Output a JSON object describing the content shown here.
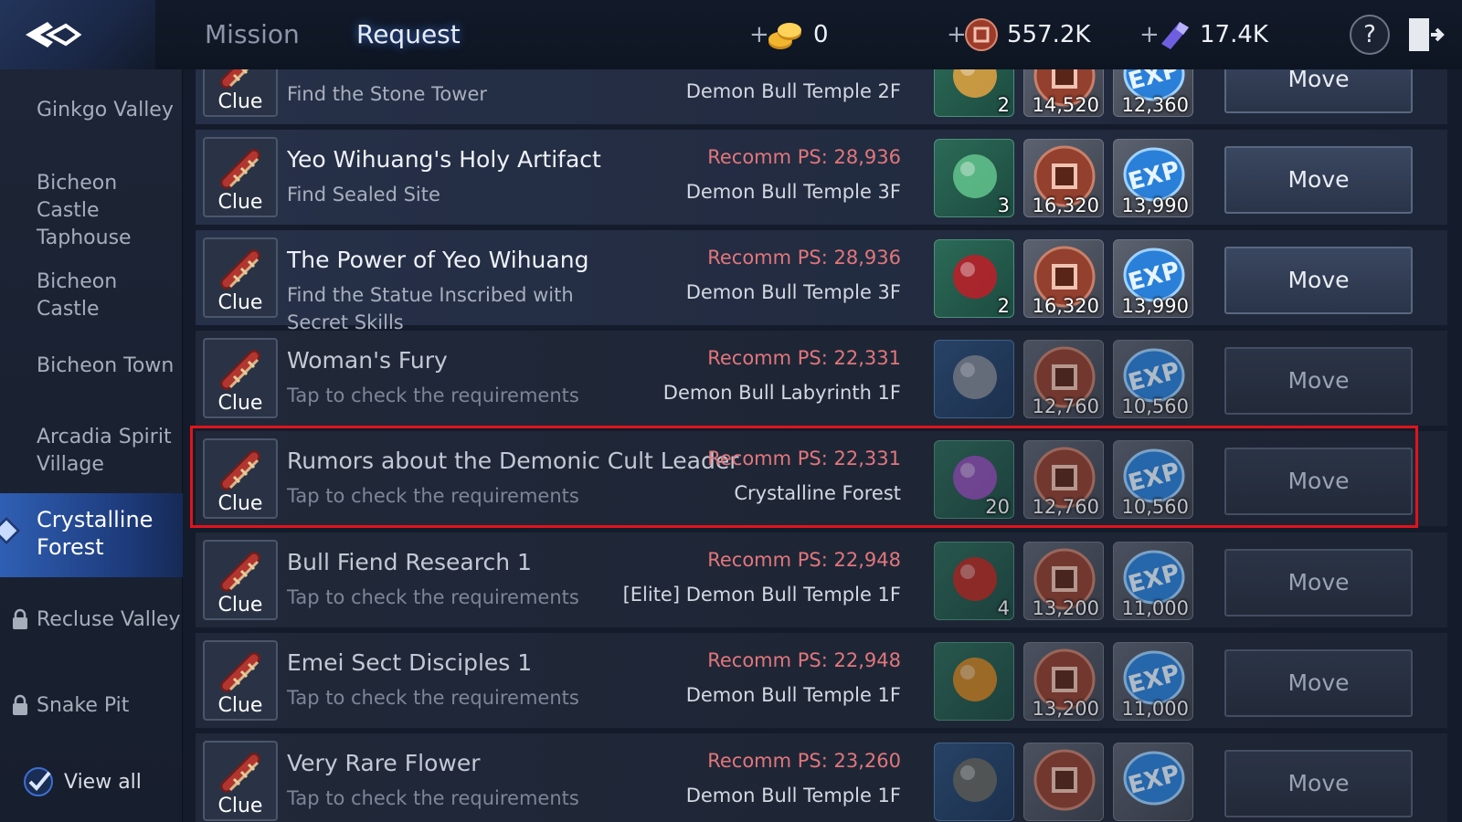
{
  "header": {
    "tabs": [
      {
        "label": "Mission"
      },
      {
        "label": "Request"
      }
    ],
    "currencies": {
      "gold": "0",
      "coin": "557.2K",
      "crystal": "17.4K"
    },
    "plus": "+",
    "help": "?"
  },
  "sidebar": {
    "items": [
      {
        "label": "Ginkgo Valley"
      },
      {
        "label": "Bicheon Castle Taphouse"
      },
      {
        "label": "Bicheon Castle"
      },
      {
        "label": "Bicheon Town"
      },
      {
        "label": "Arcadia Spirit Village"
      },
      {
        "label": "Crystalline Forest"
      },
      {
        "label": "Recluse Valley"
      },
      {
        "label": "Snake Pit"
      }
    ],
    "view_all": "View all"
  },
  "quests": [
    {
      "title": "",
      "desc": "Find the Stone Tower",
      "ps": "",
      "location": "Demon Bull Temple 2F",
      "item_count": "2",
      "coins": "14,520",
      "exp": "12,360",
      "move": "Move",
      "clue": "Clue"
    },
    {
      "title": "Yeo Wihuang's Holy Artifact",
      "desc": "Find Sealed Site",
      "ps": "Recomm PS: 28,936",
      "location": "Demon Bull Temple 3F",
      "item_count": "3",
      "coins": "16,320",
      "exp": "13,990",
      "move": "Move",
      "clue": "Clue"
    },
    {
      "title": "The Power of Yeo Wihuang",
      "desc": "Find the Statue Inscribed with Secret Skills",
      "ps": "Recomm PS: 28,936",
      "location": "Demon Bull Temple 3F",
      "item_count": "2",
      "coins": "16,320",
      "exp": "13,990",
      "move": "Move",
      "clue": "Clue"
    },
    {
      "title": "Woman's Fury",
      "desc": "Tap to check the requirements",
      "ps": "Recomm PS: 22,331",
      "location": "Demon Bull Labyrinth 1F",
      "item_count": "",
      "coins": "12,760",
      "exp": "10,560",
      "move": "Move",
      "clue": "Clue"
    },
    {
      "title": "Rumors about the Demonic Cult Leader",
      "desc": "Tap to check the requirements",
      "ps": "Recomm PS: 22,331",
      "location": "Crystalline Forest",
      "item_count": "20",
      "coins": "12,760",
      "exp": "10,560",
      "move": "Move",
      "clue": "Clue"
    },
    {
      "title": "Bull Fiend Research 1",
      "desc": "Tap to check the requirements",
      "ps": "Recomm PS: 22,948",
      "location": "[Elite] Demon Bull Temple 1F",
      "item_count": "4",
      "coins": "13,200",
      "exp": "11,000",
      "move": "Move",
      "clue": "Clue"
    },
    {
      "title": "Emei Sect Disciples 1",
      "desc": "Tap to check the requirements",
      "ps": "Recomm PS: 22,948",
      "location": "Demon Bull Temple 1F",
      "item_count": "",
      "coins": "13,200",
      "exp": "11,000",
      "move": "Move",
      "clue": "Clue"
    },
    {
      "title": "Very Rare Flower",
      "desc": "Tap to check the requirements",
      "ps": "Recomm PS: 23,260",
      "location": "Demon Bull Temple 1F",
      "item_count": "",
      "coins": "",
      "exp": "",
      "move": "Move",
      "clue": "Clue"
    }
  ],
  "colors": {
    "accent": "#2f5fb4",
    "highlight": "#e0141c",
    "ps_red": "#e2767b"
  }
}
